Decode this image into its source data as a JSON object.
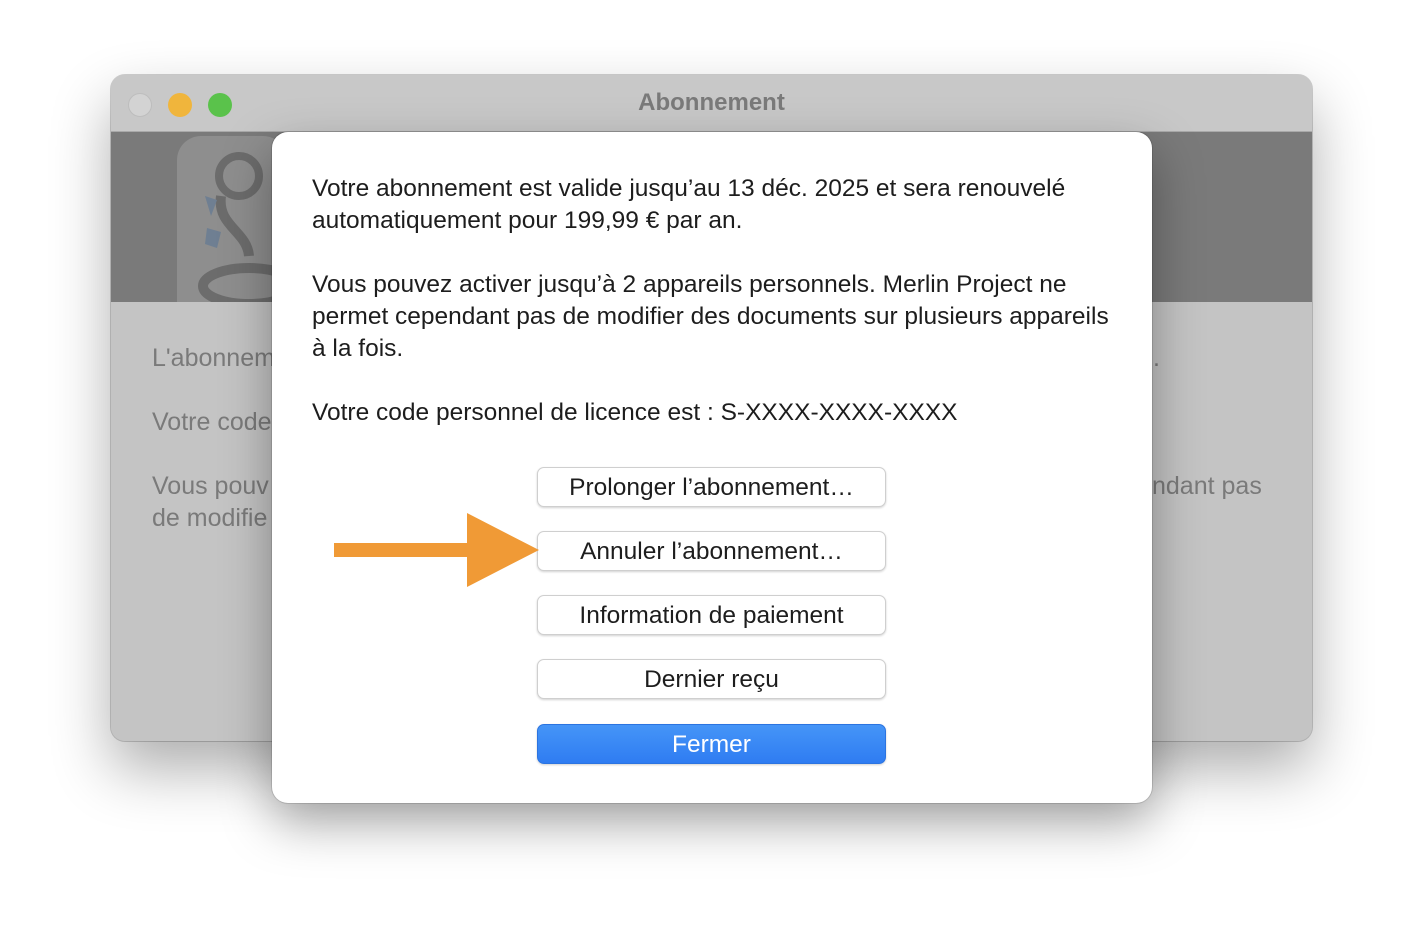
{
  "window": {
    "title": "Abonnement",
    "background_text": {
      "line1": "L'abonnem",
      "line1_right": ".",
      "line2": "Votre code",
      "line3": "Vous pouv",
      "line3_right": "ndant pas",
      "line4": "de modifie"
    }
  },
  "dialog": {
    "para1": "Votre abonnement est valide jusqu’au 13 déc. 2025 et sera renouvelé automatiquement pour 199,99 € par an.",
    "para2": "Vous pouvez activer jusqu’à 2 appareils personnels. Merlin Project ne permet cependant pas de modifier des documents sur plusieurs appareils à la fois.",
    "para3": "Votre code personnel de licence est : S-XXXX-XXXX-XXXX",
    "buttons": {
      "extend": "Prolonger l’abonnement…",
      "cancel": "Annuler l’abonnement…",
      "payment": "Information de paiement",
      "receipt": "Dernier reçu",
      "close": "Fermer"
    }
  },
  "colors": {
    "accent": "#2f7cf2",
    "arrow": "#f09a36",
    "traffic_min": "#f0b53c",
    "traffic_zoom": "#5ac24b"
  }
}
